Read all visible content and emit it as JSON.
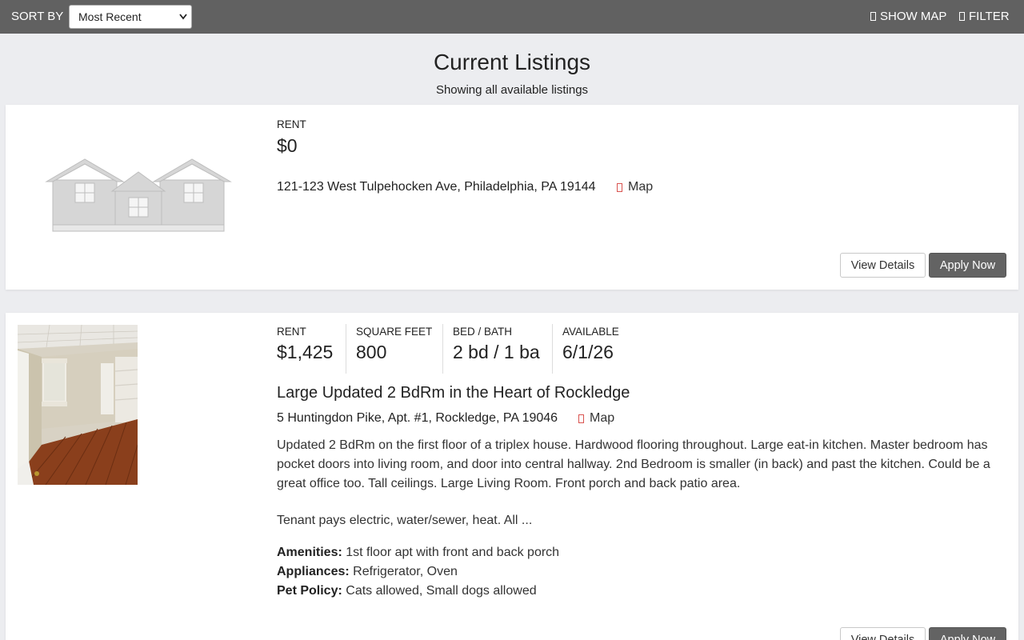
{
  "toolbar": {
    "sort_label": "SORT BY",
    "sort_selected": "Most Recent",
    "show_map_label": "SHOW MAP",
    "filter_label": "FILTER"
  },
  "header": {
    "title": "Current Listings",
    "subtitle": "Showing all available listings"
  },
  "listings": [
    {
      "image": "placeholder-house-illustration",
      "rent_label": "RENT",
      "rent": "$0",
      "address": "121-123 West Tulpehocken Ave, Philadelphia, PA 19144",
      "map_label": "Map",
      "view_label": "View Details",
      "apply_label": "Apply Now"
    },
    {
      "image": "interior-room-photo",
      "rent_label": "RENT",
      "rent": "$1,425",
      "sqft_label": "SQUARE FEET",
      "sqft": "800",
      "bedbath_label": "BED / BATH",
      "bedbath": "2 bd / 1 ba",
      "available_label": "AVAILABLE",
      "available": "6/1/26",
      "title": "Large Updated 2 BdRm in the Heart of Rockledge",
      "address": "5 Huntingdon Pike, Apt. #1, Rockledge, PA 19046",
      "map_label": "Map",
      "description": "Updated 2 BdRm on the first floor of a triplex house. Hardwood flooring throughout. Large eat-in kitchen. Master bedroom has pocket doors into living room, and door into central hallway. 2nd Bedroom is smaller (in back) and past the kitchen. Could be a great office too. Tall ceilings. Large Living Room. Front porch and back patio area.",
      "description2": "Tenant pays electric, water/sewer, heat. All ...",
      "amenities_label": "Amenities:",
      "amenities": "1st floor apt with front and back porch",
      "appliances_label": "Appliances:",
      "appliances": "Refrigerator, Oven",
      "pets_label": "Pet Policy:",
      "pets": "Cats allowed, Small dogs allowed",
      "view_label": "View Details",
      "apply_label": "Apply Now"
    }
  ],
  "colors": {
    "topbar": "#616161",
    "page_bg": "#ecedf0",
    "apply_button": "#636363",
    "map_pin": "#d9534f"
  }
}
